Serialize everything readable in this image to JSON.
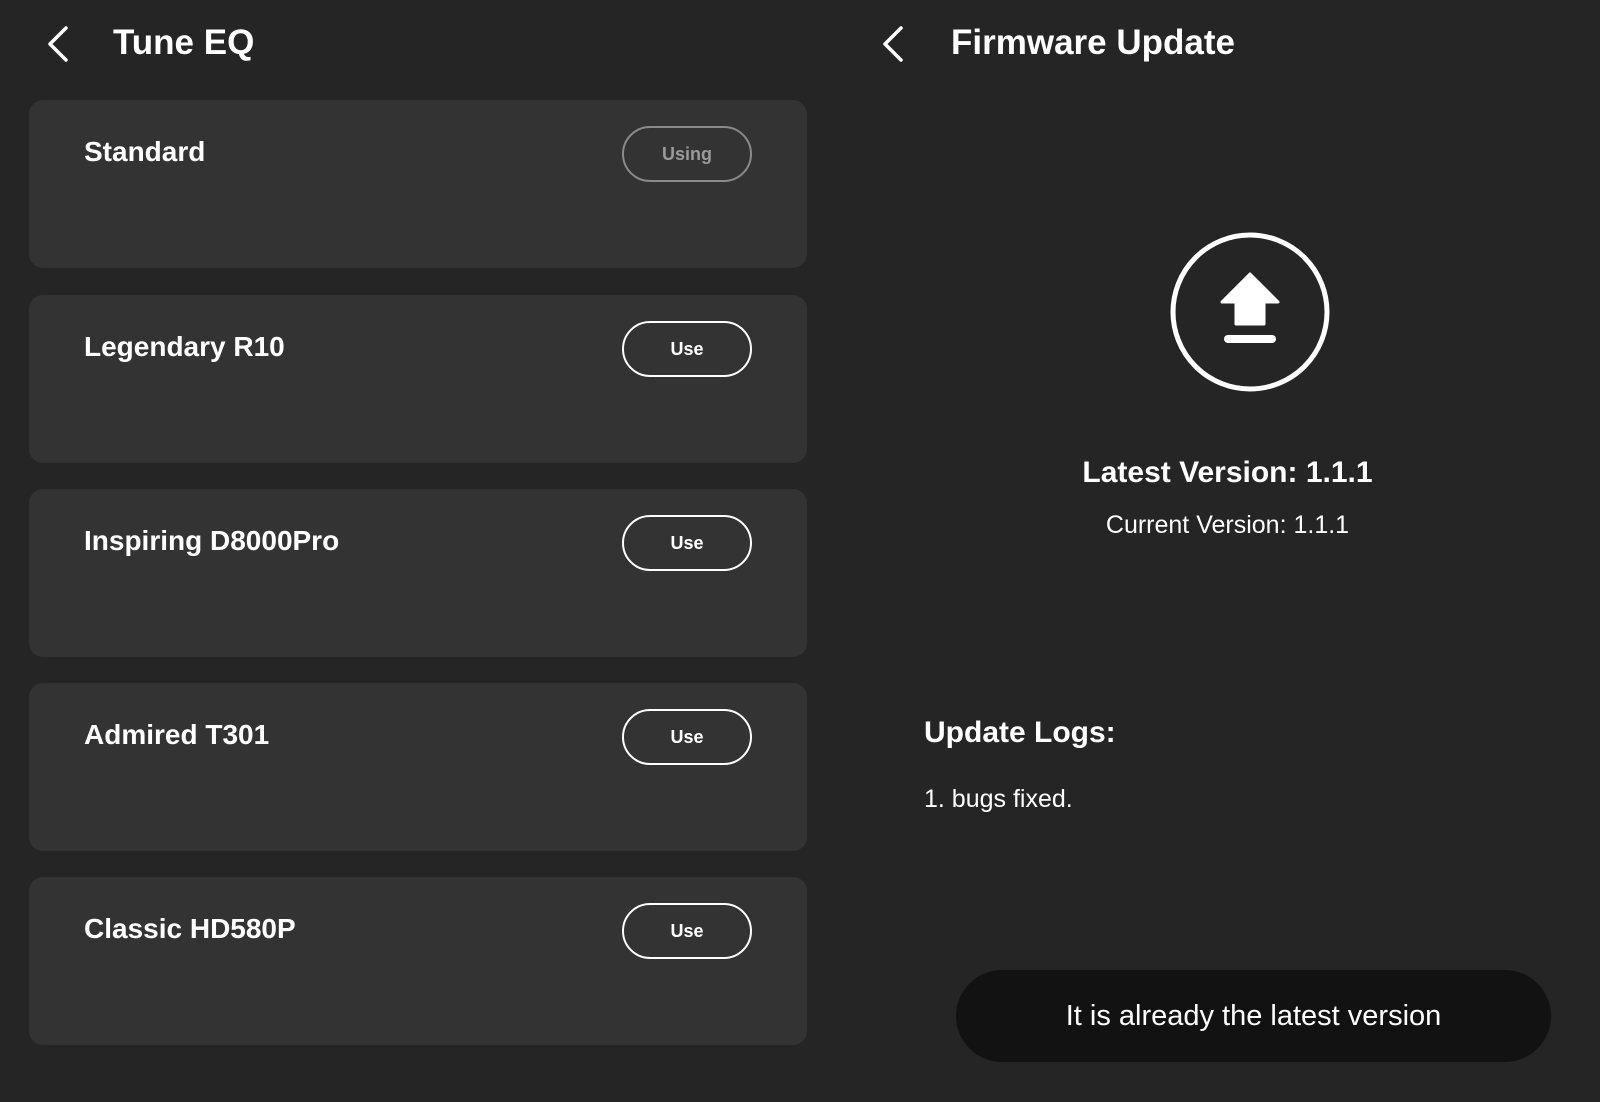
{
  "tune_eq": {
    "title": "Tune EQ",
    "presets": [
      {
        "name": "Standard",
        "button": "Using"
      },
      {
        "name": "Legendary R10",
        "button": "Use"
      },
      {
        "name": "Inspiring D8000Pro",
        "button": "Use"
      },
      {
        "name": "Admired T301",
        "button": "Use"
      },
      {
        "name": "Classic HD580P",
        "button": "Use"
      }
    ]
  },
  "firmware": {
    "title": "Firmware Update",
    "icon": "upload-icon",
    "latest_version": "Latest Version: 1.1.1",
    "current_version": "Current Version: 1.1.1",
    "logs_title": "Update Logs:",
    "log_items": [
      "1. bugs fixed."
    ],
    "status": "It is already the latest version"
  },
  "icons": {
    "back": "chevron-left-icon",
    "upload": "upload-icon"
  },
  "colors": {
    "background": "#252525",
    "card": "#333333",
    "status_pill": "#121212",
    "text": "#ffffff",
    "using_button": "#8a8a8a"
  }
}
